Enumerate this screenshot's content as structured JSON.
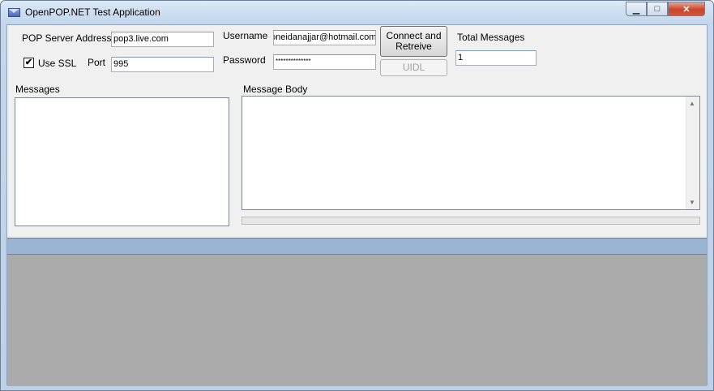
{
  "window": {
    "title": "OpenPOP.NET Test Application",
    "controls": {
      "minimize": "▁",
      "maximize": "□",
      "close": "✕"
    }
  },
  "form": {
    "pop_server_label": "POP Server Address",
    "pop_server_value": "pop3.live.com",
    "use_ssl_label": "Use SSL",
    "use_ssl_checked": "✔",
    "port_label": "Port",
    "port_value": "995",
    "username_label": "Username",
    "username_value": "oneidanajjar@hotmail.com",
    "password_label": "Password",
    "password_value": "**************",
    "connect_button": "Connect and Retreive",
    "uidl_button": "UIDL",
    "total_messages_label": "Total Messages",
    "total_messages_value": "1"
  },
  "messages": {
    "label": "Messages"
  },
  "message_body": {
    "label": "Message Body",
    "scroll_up": "▲",
    "scroll_down": "▼"
  },
  "colors": {
    "grid_header": "#9bb4d2",
    "grid_background": "#ababab",
    "close_button": "#c8452a"
  },
  "icons": {
    "app": "envelope-icon"
  }
}
